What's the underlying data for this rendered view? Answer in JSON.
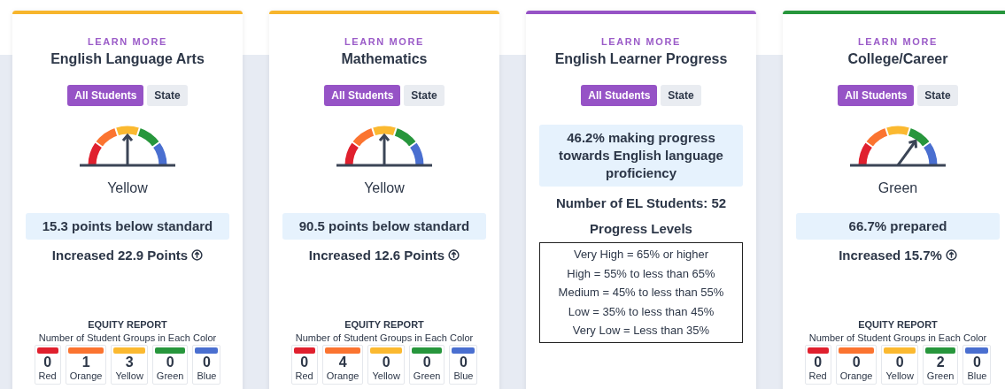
{
  "cards": [
    {
      "kind": "gauge",
      "color": "#f7b52c",
      "link": "LEARN MORE",
      "title": "English Language Arts",
      "toggle": [
        {
          "label": "All Students",
          "selected": true
        },
        {
          "label": "State",
          "selected": false
        }
      ],
      "gauge": {
        "kind": "yellow",
        "label": "Yellow"
      },
      "status": "15.3 points below standard",
      "change": "Increased 22.9 Points",
      "equity": {
        "title": "EQUITY REPORT",
        "subtitle": "Number of Student Groups in Each Color",
        "groups": [
          {
            "color": "#e0202e",
            "count": "0",
            "label": "Red"
          },
          {
            "color": "#fb7430",
            "count": "1",
            "label": "Orange"
          },
          {
            "color": "#fbb930",
            "count": "3",
            "label": "Yellow"
          },
          {
            "color": "#27963c",
            "count": "0",
            "label": "Green"
          },
          {
            "color": "#4a6fd0",
            "count": "0",
            "label": "Blue"
          }
        ]
      }
    },
    {
      "kind": "gauge",
      "color": "#f7b52c",
      "link": "LEARN MORE",
      "title": "Mathematics",
      "toggle": [
        {
          "label": "All Students",
          "selected": true
        },
        {
          "label": "State",
          "selected": false
        }
      ],
      "gauge": {
        "kind": "yellow",
        "label": "Yellow"
      },
      "status": "90.5 points below standard",
      "change": "Increased 12.6 Points",
      "equity": {
        "title": "EQUITY REPORT",
        "subtitle": "Number of Student Groups in Each Color",
        "groups": [
          {
            "color": "#e0202e",
            "count": "0",
            "label": "Red"
          },
          {
            "color": "#fb7430",
            "count": "4",
            "label": "Orange"
          },
          {
            "color": "#fbb930",
            "count": "0",
            "label": "Yellow"
          },
          {
            "color": "#27963c",
            "count": "0",
            "label": "Green"
          },
          {
            "color": "#4a6fd0",
            "count": "0",
            "label": "Blue"
          }
        ]
      }
    },
    {
      "kind": "progress",
      "color": "#9653c6",
      "link": "LEARN MORE",
      "title": "English Learner Progress",
      "toggle": [
        {
          "label": "All Students",
          "selected": true
        },
        {
          "label": "State",
          "selected": false
        }
      ],
      "status": "46.2% making progress towards English language proficiency",
      "count": "Number of EL Students: 52",
      "levels_title": "Progress Levels",
      "levels": [
        "Very High = 65% or higher",
        "High = 55% to less than 65%",
        "Medium = 45% to less than 55%",
        "Low = 35% to less than 45%",
        "Very Low = Less than 35%"
      ]
    },
    {
      "kind": "gauge",
      "color": "#27963c",
      "link": "LEARN MORE",
      "title": "College/Career",
      "toggle": [
        {
          "label": "All Students",
          "selected": true
        },
        {
          "label": "State",
          "selected": false
        }
      ],
      "gauge": {
        "kind": "green",
        "label": "Green"
      },
      "status": "66.7% prepared",
      "change": "Increased 15.7%",
      "equity": {
        "title": "EQUITY REPORT",
        "subtitle": "Number of Student Groups in Each Color",
        "groups": [
          {
            "color": "#e0202e",
            "count": "0",
            "label": "Red"
          },
          {
            "color": "#fb7430",
            "count": "0",
            "label": "Orange"
          },
          {
            "color": "#fbb930",
            "count": "0",
            "label": "Yellow"
          },
          {
            "color": "#27963c",
            "count": "2",
            "label": "Green"
          },
          {
            "color": "#4a6fd0",
            "count": "0",
            "label": "Blue"
          }
        ]
      }
    }
  ]
}
